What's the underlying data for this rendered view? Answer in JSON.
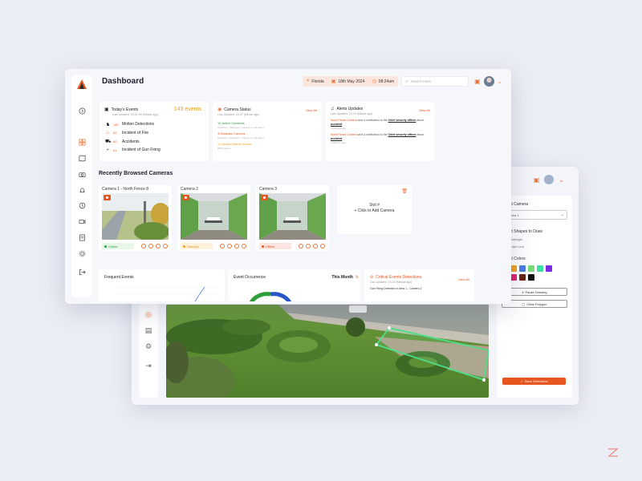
{
  "dashboard": {
    "title": "Dashboard",
    "topbar": {
      "location": "Florida",
      "date": "18th May 2024",
      "time": "08:24am",
      "search_placeholder": "Search Here"
    },
    "todays_events": {
      "title": "Today's Events",
      "subtitle": "Last Updated: 20-01-05 (Minute ago)",
      "count": "143 events",
      "items": [
        {
          "num": "140",
          "label": "Motion Detections"
        },
        {
          "num": "02",
          "label": "Incident of Fire"
        },
        {
          "num": "00",
          "label": "Accidents"
        },
        {
          "num": "01",
          "label": "Incident of Gun Firing"
        }
      ]
    },
    "camera_status": {
      "title": "Camera Status",
      "subtitle": "Last Updated: 20-07 (Minute ago)",
      "view_all": "View All",
      "active": "12 Active Cameras",
      "active_sub": "Camera 1, Camera 2, Camera 3, Camera 4",
      "disabled": "3 Disabled Camera",
      "disabled_sub": "Camera 1, Camera 2, Camera 3, Camera 4",
      "action": "1 Camera Needs Action",
      "action_sub": "Offline Issue"
    },
    "alerts": {
      "title": "Alerts Updates",
      "subtitle": "Last Updated: 20-24 (Minute ago)",
      "view_all": "View All",
      "items": [
        {
          "source": "North Fence Camera",
          "mid": " sent a notification to the ",
          "who": "Chief security officer",
          "tail": " about ",
          "what": "accident",
          "sub": "4 Minutes ago"
        },
        {
          "source": "North Fence Camera",
          "mid": " sent a notification to the ",
          "who": "Chief security officer",
          "tail": " about ",
          "what": "accident",
          "sub": "6 Minutes ago"
        }
      ]
    },
    "recent_title": "Recently Browsed Cameras",
    "cameras": [
      {
        "name": "Camera 1 - North Fence 8",
        "status": "Online"
      },
      {
        "name": "Camera 2",
        "status": "Standby"
      },
      {
        "name": "Camera 3",
        "status": "Offline"
      }
    ],
    "slot": {
      "title": "Slot #",
      "action": "+ Click to Add Camera"
    },
    "frequent_events": {
      "title": "Frequent Events"
    },
    "event_occurrence": {
      "title": "Event Occurrence",
      "period": "This Month"
    },
    "critical": {
      "title": "Critical Events Detections",
      "subtitle": "Last Updated: 20-20 (Minute ago)",
      "view_all": "View All",
      "line": "Gun Firing Detected in Area 1 - Camera 2"
    }
  },
  "editor": {
    "select_camera_label": "Select Camera",
    "camera_value": "Camera 1",
    "shapes_label": "Select Shapes to Draw",
    "shapes": [
      "Rectangle",
      "Single Line"
    ],
    "colors_label": "Select Colors",
    "colors": [
      "#e02020",
      "#f0a020",
      "#4a7de8",
      "#7adc7a",
      "#3ee0a0",
      "#7a2ae0",
      "#e84ae0",
      "#e02070",
      "#6a2010",
      "#111111"
    ],
    "pause_label": "Pause Drawing",
    "clear_label": "Clear Polygon",
    "save_label": "Save Selections"
  }
}
